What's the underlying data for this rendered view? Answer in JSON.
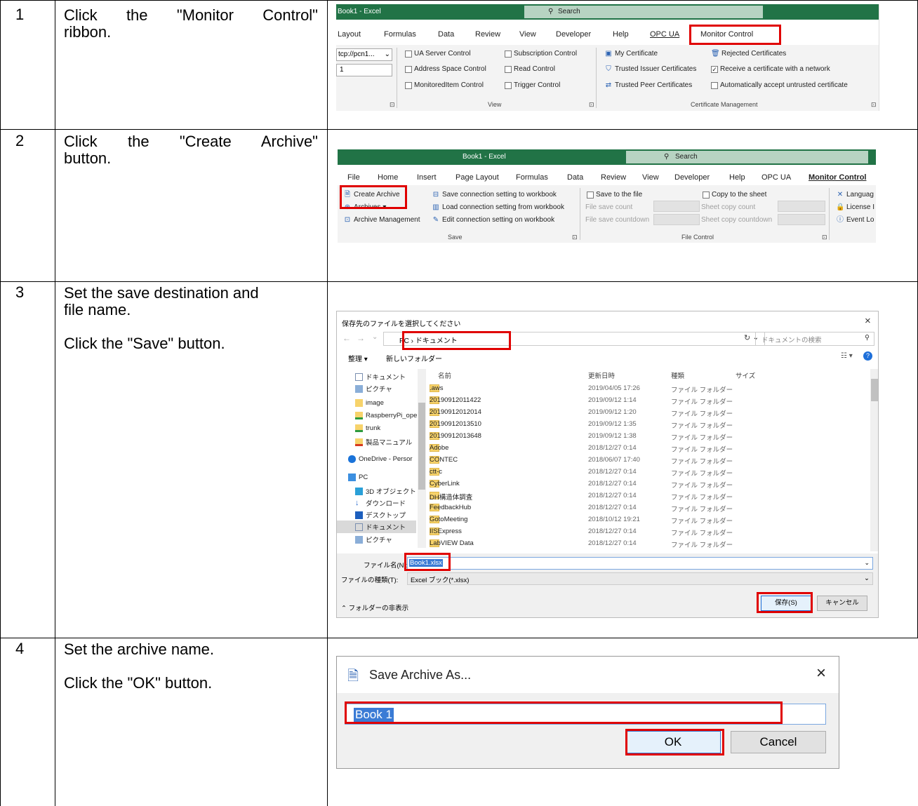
{
  "steps": [
    {
      "number": "1",
      "lines": [
        "Click the \"Monitor Control\"",
        "ribbon."
      ]
    },
    {
      "number": "2",
      "lines": [
        "Click the \"Create Archive\"",
        "button."
      ]
    },
    {
      "number": "3",
      "lines": [
        "Set the save destination and",
        "file name.",
        "Click the \"Save\" button."
      ]
    },
    {
      "number": "4",
      "lines": [
        "Set the archive name.",
        "Click the \"OK\" button."
      ]
    }
  ],
  "shot1": {
    "title": "Book1 - Excel",
    "search": "Search",
    "tabs": [
      "Layout",
      "Formulas",
      "Data",
      "Review",
      "View",
      "Developer",
      "Help",
      "OPC UA",
      "Monitor Control"
    ],
    "server_combo": "tcp://pcn1...",
    "server_field": "1",
    "view_items": [
      "UA Server Control",
      "Subscription Control",
      "Address Space Control",
      "Read Control",
      "MonitoredItem Control",
      "Trigger Control"
    ],
    "cert_items": [
      "My Certificate",
      "Rejected Certificates",
      "Trusted Issuer Certificates",
      "Receive a certificate with a network",
      "Trusted Peer Certificates",
      "Automatically accept untrusted certificate"
    ],
    "group_view": "View",
    "group_cert": "Certificate Management"
  },
  "shot2": {
    "title": "Book1 - Excel",
    "search": "Search",
    "tabs": [
      "File",
      "Home",
      "Insert",
      "Page Layout",
      "Formulas",
      "Data",
      "Review",
      "View",
      "Developer",
      "Help",
      "OPC UA",
      "Monitor Control"
    ],
    "save_items": [
      "Create Archive",
      "Archives",
      "Archive Management",
      "Save connection setting to workbook",
      "Load connection setting from workbook",
      "Edit connection setting on workbook"
    ],
    "file_items": [
      "Save to the file",
      "File save count",
      "File save countdown",
      "Copy to the sheet",
      "Sheet copy count",
      "Sheet copy countdown"
    ],
    "right_items": [
      "Languag",
      "License I",
      "Event Lo"
    ],
    "group_save": "Save",
    "group_file": "File Control"
  },
  "shot3": {
    "title": "保存先のファイルを選択してください",
    "close": "×",
    "path": [
      "PC",
      "ドキュメント"
    ],
    "search_placeholder": "ドキュメントの検索",
    "organize": "整理 ▾",
    "new_folder": "新しいフォルダー",
    "nav": [
      "ドキュメント",
      "ピクチャ",
      "image",
      "RaspberryPi_ope",
      "trunk",
      "製品マニュアル",
      "OneDrive - Persor",
      "PC",
      "3D オブジェクト",
      "ダウンロード",
      "デスクトップ",
      "ドキュメント",
      "ピクチャ"
    ],
    "columns": [
      "名前",
      "更新日時",
      "種類",
      "サイズ"
    ],
    "rows": [
      [
        ".aws",
        "2019/04/05 17:26",
        "ファイル フォルダー"
      ],
      [
        "20190912011422",
        "2019/09/12 1:14",
        "ファイル フォルダー"
      ],
      [
        "20190912012014",
        "2019/09/12 1:20",
        "ファイル フォルダー"
      ],
      [
        "20190912013510",
        "2019/09/12 1:35",
        "ファイル フォルダー"
      ],
      [
        "20190912013648",
        "2019/09/12 1:38",
        "ファイル フォルダー"
      ],
      [
        "Adobe",
        "2018/12/27 0:14",
        "ファイル フォルダー"
      ],
      [
        "CONTEC",
        "2018/06/07 17:40",
        "ファイル フォルダー"
      ],
      [
        "ctt-c",
        "2018/12/27 0:14",
        "ファイル フォルダー"
      ],
      [
        "CyberLink",
        "2018/12/27 0:14",
        "ファイル フォルダー"
      ],
      [
        "DH構造体調査",
        "2018/12/27 0:14",
        "ファイル フォルダー"
      ],
      [
        "FeedbackHub",
        "2018/12/27 0:14",
        "ファイル フォルダー"
      ],
      [
        "GotoMeeting",
        "2018/10/12 19:21",
        "ファイル フォルダー"
      ],
      [
        "IISExpress",
        "2018/12/27 0:14",
        "ファイル フォルダー"
      ],
      [
        "LabVIEW Data",
        "2018/12/27 0:14",
        "ファイル フォルダー"
      ]
    ],
    "filename_label": "ファイル名(N):",
    "filename_value": "Book1.xlsx",
    "filetype_label": "ファイルの種類(T):",
    "filetype_value": "Excel ブック(*.xlsx)",
    "hide_folders": "フォルダーの非表示",
    "save_btn": "保存(S)",
    "cancel_btn": "キャンセル"
  },
  "shot4": {
    "title": "Save Archive As...",
    "close": "×",
    "name_value": "Book 1",
    "ok": "OK",
    "cancel": "Cancel"
  },
  "colors": {
    "excel_green": "#217346",
    "highlight_red": "#e00000",
    "selection_blue": "#3a7bd5"
  }
}
